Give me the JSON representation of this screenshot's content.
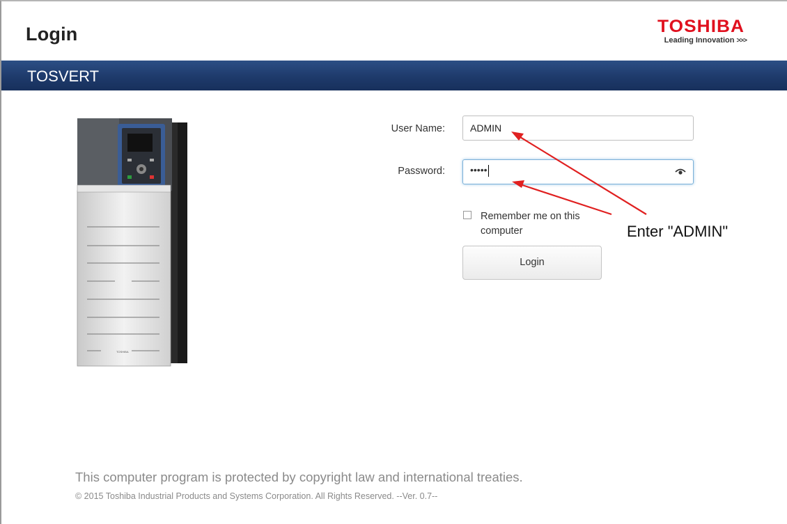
{
  "header": {
    "title": "Login",
    "logo": {
      "name": "TOSHIBA",
      "tagline": "Leading Innovation",
      "chevrons": ">>>"
    },
    "brand_color": "#e0101e"
  },
  "band": {
    "title": "TOSVERT",
    "color": "#1e3a6b"
  },
  "device_image": {
    "icon": "inverter-device-icon",
    "brand_text": "TOSHIBA"
  },
  "form": {
    "username": {
      "label": "User Name:",
      "value": "ADMIN"
    },
    "password": {
      "label": "Password:",
      "value": "•••••",
      "reveal_icon": "eye-icon"
    },
    "remember": {
      "label": "Remember me on this computer",
      "checked": false
    },
    "login_button": "Login"
  },
  "annotation": {
    "text": "Enter \"ADMIN\"",
    "color": "#e02020"
  },
  "footer": {
    "notice": "This computer program is protected by copyright law and international treaties.",
    "copyright": "© 2015 Toshiba Industrial Products and Systems Corporation. All Rights Reserved. --Ver. 0.7--"
  }
}
